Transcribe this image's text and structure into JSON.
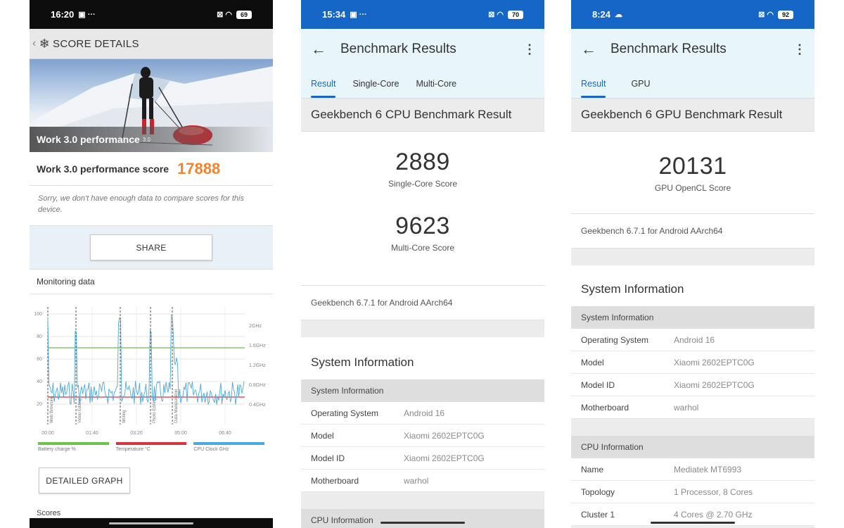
{
  "phone1": {
    "status": {
      "time": "16:20",
      "battery": "69"
    },
    "header_title": "SCORE DETAILS",
    "hero_title": "Work 3.0 performance",
    "hero_version": "3.0",
    "score_label": "Work 3.0 performance score",
    "score_value": "17888",
    "sorry_text": "Sorry, we don't have enough data to compare scores for this device.",
    "share_label": "SHARE",
    "monitoring_title": "Monitoring data",
    "graph": {
      "y_left": [
        "100",
        "80",
        "60",
        "40",
        "20"
      ],
      "y_right": [
        "2GHz",
        "1.6GHz",
        "1.2GHz",
        "0.8GHz",
        "0.4GHz"
      ],
      "x_ticks": [
        "00:00",
        "01:40",
        "03:20",
        "05:00",
        "06:40"
      ],
      "markers": [
        "Web Browsing",
        "Video Editing",
        "Writing",
        "Photo Editing",
        "Data Manipulation"
      ]
    },
    "legend": [
      {
        "label": "Battery charge %",
        "color": "#6cc24a"
      },
      {
        "label": "Temperature °C",
        "color": "#d8353a"
      },
      {
        "label": "CPU Clock GHz",
        "color": "#4aa8e0"
      }
    ],
    "detailed_label": "DETAILED GRAPH",
    "scores_label": "Scores"
  },
  "phone2": {
    "status": {
      "time": "15:34",
      "battery": "70"
    },
    "app_title": "Benchmark Results",
    "tabs": [
      "Result",
      "Single-Core",
      "Multi-Core"
    ],
    "section_title": "Geekbench 6 CPU Benchmark Result",
    "scores": [
      {
        "value": "2889",
        "label": "Single-Core Score"
      },
      {
        "value": "9623",
        "label": "Multi-Core Score"
      }
    ],
    "version": "Geekbench 6.7.1 for Android AArch64",
    "sysinfo_title": "System Information",
    "sub_header": "System Information",
    "rows": [
      {
        "k": "Operating System",
        "v": "Android 16"
      },
      {
        "k": "Model",
        "v": "Xiaomi 2602EPTC0G"
      },
      {
        "k": "Model ID",
        "v": "Xiaomi 2602EPTC0G"
      },
      {
        "k": "Motherboard",
        "v": "warhol"
      }
    ],
    "cpu_header": "CPU Information"
  },
  "phone3": {
    "status": {
      "time": "8:24",
      "battery": "92"
    },
    "app_title": "Benchmark Results",
    "tabs": [
      "Result",
      "GPU"
    ],
    "section_title": "Geekbench 6 GPU Benchmark Result",
    "score": {
      "value": "20131",
      "label": "GPU OpenCL Score"
    },
    "version": "Geekbench 6.7.1 for Android AArch64",
    "sysinfo_title": "System Information",
    "sub_header": "System Information",
    "rows": [
      {
        "k": "Operating System",
        "v": "Android 16"
      },
      {
        "k": "Model",
        "v": "Xiaomi 2602EPTC0G"
      },
      {
        "k": "Model ID",
        "v": "Xiaomi 2602EPTC0G"
      },
      {
        "k": "Motherboard",
        "v": "warhol"
      }
    ],
    "cpu_header": "CPU Information",
    "cpu_rows": [
      {
        "k": "Name",
        "v": "Mediatek MT6993"
      },
      {
        "k": "Topology",
        "v": "1 Processor, 8 Cores"
      },
      {
        "k": "Cluster 1",
        "v": "4 Cores @ 2.70 GHz"
      }
    ]
  }
}
